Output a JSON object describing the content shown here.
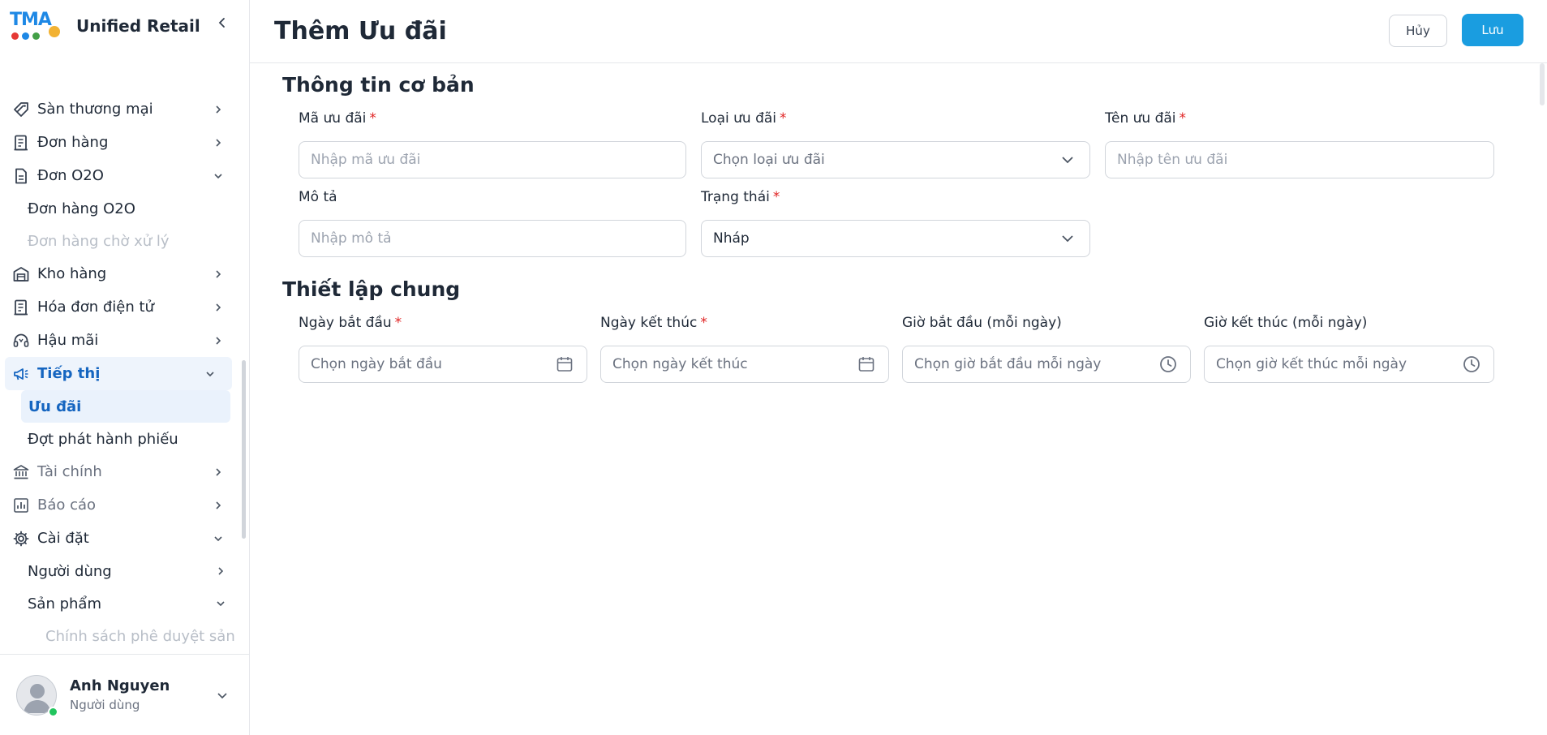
{
  "brand": {
    "logo_text": "TMA",
    "name": "Unified Retail"
  },
  "sidebar": {
    "items": [
      {
        "label": "Sàn thương mại",
        "icon": "tag-icon"
      },
      {
        "label": "Đơn hàng",
        "icon": "receipt-icon"
      },
      {
        "label": "Đơn O2O",
        "icon": "document-icon"
      },
      {
        "label": "Đơn hàng O2O"
      },
      {
        "label": "Đơn hàng chờ xử lý"
      },
      {
        "label": "Kho hàng",
        "icon": "warehouse-icon"
      },
      {
        "label": "Hóa đơn điện tử",
        "icon": "invoice-icon"
      },
      {
        "label": "Hậu mãi",
        "icon": "headset-icon"
      },
      {
        "label": "Tiếp thị",
        "icon": "megaphone-icon"
      },
      {
        "label": "Ưu đãi"
      },
      {
        "label": "Đợt phát hành phiếu"
      },
      {
        "label": "Tài chính",
        "icon": "bank-icon"
      },
      {
        "label": "Báo cáo",
        "icon": "chart-icon"
      },
      {
        "label": "Cài đặt",
        "icon": "gear-icon"
      },
      {
        "label": "Người dùng"
      },
      {
        "label": "Sản phẩm"
      },
      {
        "label": "Chính sách phê duyệt sản"
      }
    ]
  },
  "user": {
    "name": "Anh Nguyen",
    "role": "Người dùng"
  },
  "header": {
    "title": "Thêm Ưu đãi",
    "cancel_label": "Hủy",
    "save_label": "Lưu"
  },
  "basic_info": {
    "title": "Thông tin cơ bản",
    "code": {
      "label": "Mã ưu đãi",
      "placeholder": "Nhập mã ưu đãi"
    },
    "type": {
      "label": "Loại ưu đãi",
      "placeholder": "Chọn loại ưu đãi"
    },
    "name": {
      "label": "Tên ưu đãi",
      "placeholder": "Nhập tên ưu đãi"
    },
    "description": {
      "label": "Mô tả",
      "placeholder": "Nhập mô tả"
    },
    "status": {
      "label": "Trạng thái",
      "value": "Nháp"
    }
  },
  "general_settings": {
    "title": "Thiết lập chung",
    "start_date": {
      "label": "Ngày bắt đầu",
      "placeholder": "Chọn ngày bắt đầu"
    },
    "end_date": {
      "label": "Ngày kết thúc",
      "placeholder": "Chọn ngày kết thúc"
    },
    "start_time": {
      "label": "Giờ bắt đầu (mỗi ngày)",
      "placeholder": "Chọn giờ bắt đầu mỗi ngày"
    },
    "end_time": {
      "label": "Giờ kết thúc (mỗi ngày)",
      "placeholder": "Chọn giờ kết thúc mỗi ngày"
    }
  },
  "colors": {
    "accent": "#1a9de0",
    "active_text": "#1565c0",
    "required": "#e02424",
    "online": "#22c55e"
  }
}
